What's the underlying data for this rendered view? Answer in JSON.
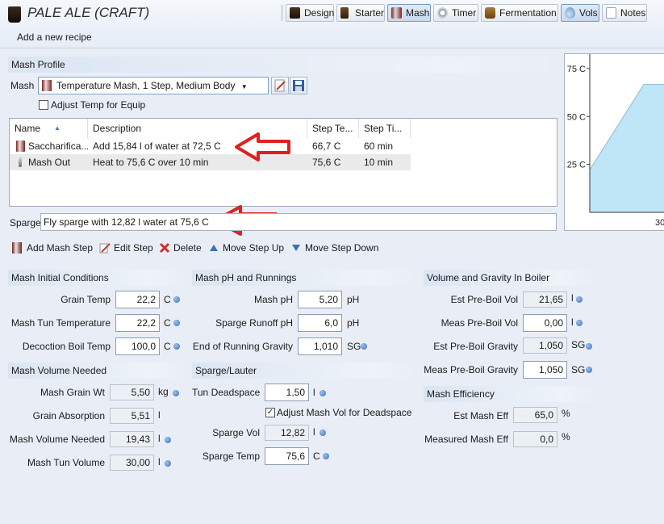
{
  "header": {
    "title": "PALE ALE (CRAFT)",
    "subtitle": "Add a new recipe"
  },
  "toolbar": {
    "tabs": [
      {
        "label": "Design",
        "icon": "beer-glass-icon",
        "active": false
      },
      {
        "label": "Starter",
        "icon": "starter-glass-icon",
        "active": false
      },
      {
        "label": "Mash",
        "icon": "mash-tun-icon",
        "active": true
      },
      {
        "label": "Timer",
        "icon": "timer-icon",
        "active": false
      },
      {
        "label": "Fermentation",
        "icon": "fermenter-icon",
        "active": false
      },
      {
        "label": "Vols",
        "icon": "droplet-icon",
        "active": true
      },
      {
        "label": "Notes",
        "icon": "notes-icon",
        "active": false
      }
    ]
  },
  "mash_profile": {
    "section_title": "Mash Profile",
    "mash_label": "Mash",
    "mash_value": "Temperature Mash, 1 Step, Medium Body",
    "adjust_temp_label": "Adjust Temp for Equip",
    "adjust_temp_checked": false
  },
  "steps_table": {
    "columns": [
      "Name",
      "Description",
      "Step Te...",
      "Step Ti..."
    ],
    "rows": [
      {
        "name": "Saccharifica...",
        "description": "Add 15,84 l of water at 72,5 C",
        "temp": "66,7 C",
        "time": "60 min"
      },
      {
        "name": "Mash Out",
        "description": "Heat to 75,6 C over 10 min",
        "temp": "75,6 C",
        "time": "10 min"
      }
    ]
  },
  "sparge": {
    "label": "Sparge",
    "value": "Fly sparge with 12,82 l water at 75,6 C"
  },
  "actions": {
    "add": "Add Mash Step",
    "edit": "Edit Step",
    "delete": "Delete",
    "up": "Move Step Up",
    "down": "Move Step Down"
  },
  "initial_conditions": {
    "title": "Mash Initial Conditions",
    "grain_temp_label": "Grain Temp",
    "grain_temp": "22,2",
    "grain_temp_unit": "C",
    "tun_temp_label": "Mash Tun Temperature",
    "tun_temp": "22,2",
    "tun_temp_unit": "C",
    "decoction_label": "Decoction Boil Temp",
    "decoction": "100,0",
    "decoction_unit": "C"
  },
  "volume_needed": {
    "title": "Mash Volume Needed",
    "grain_wt_label": "Mash Grain Wt",
    "grain_wt": "5,50",
    "grain_wt_unit": "kg",
    "absorption_label": "Grain Absorption",
    "absorption": "5,51",
    "absorption_unit": "l",
    "volume_label": "Mash Volume Needed",
    "volume": "19,43",
    "volume_unit": "l",
    "tun_volume_label": "Mash Tun Volume",
    "tun_volume": "30,00",
    "tun_volume_unit": "l"
  },
  "ph_runnings": {
    "title": "Mash pH and Runnings",
    "mash_ph_label": "Mash pH",
    "mash_ph": "5,20",
    "mash_ph_unit": "pH",
    "runoff_label": "Sparge Runoff pH",
    "runoff": "6,0",
    "runoff_unit": "pH",
    "end_gravity_label": "End of Running Gravity",
    "end_gravity": "1,010",
    "end_gravity_unit": "SG"
  },
  "sparge_lauter": {
    "title": "Sparge/Lauter",
    "deadspace_label": "Tun Deadspace",
    "deadspace": "1,50",
    "deadspace_unit": "l",
    "adjust_label": "Adjust Mash Vol for Deadspace",
    "adjust_checked": true,
    "sparge_vol_label": "Sparge Vol",
    "sparge_vol": "12,82",
    "sparge_vol_unit": "l",
    "sparge_temp_label": "Sparge Temp",
    "sparge_temp": "75,6",
    "sparge_temp_unit": "C"
  },
  "boiler": {
    "title": "Volume and Gravity In Boiler",
    "est_vol_label": "Est Pre-Boil Vol",
    "est_vol": "21,65",
    "est_vol_unit": "l",
    "meas_vol_label": "Meas Pre-Boil Vol",
    "meas_vol": "0,00",
    "meas_vol_unit": "l",
    "est_grav_label": "Est Pre-Boil Gravity",
    "est_grav": "1,050",
    "est_grav_unit": "SG",
    "meas_grav_label": "Meas Pre-Boil Gravity",
    "meas_grav": "1,050",
    "meas_grav_unit": "SG"
  },
  "efficiency": {
    "title": "Mash Efficiency",
    "est_label": "Est Mash Eff",
    "est": "65,0",
    "est_unit": "%",
    "meas_label": "Measured Mash Eff",
    "meas": "0,0",
    "meas_unit": "%"
  },
  "chart_data": {
    "type": "area",
    "y_ticks": [
      "75 C",
      "50 C",
      "25 C"
    ],
    "x_tick_partial": "30",
    "ylim": [
      0,
      80
    ],
    "series": [
      {
        "points": [
          [
            0,
            22.2
          ],
          [
            10,
            66.7
          ],
          [
            20,
            66.7
          ],
          [
            30,
            75.6
          ]
        ]
      }
    ],
    "fill_color": "#bfe6f7",
    "line_color": "#8fb8d0"
  },
  "colors": {
    "annotation_arrow": "#e02020",
    "accent": "#3c6fb8"
  }
}
